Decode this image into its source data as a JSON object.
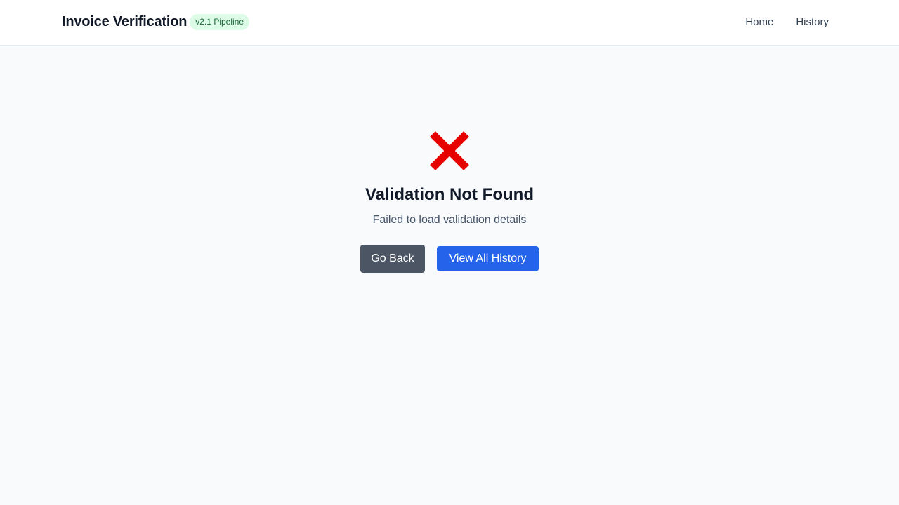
{
  "header": {
    "title": "Invoice Verification",
    "badge": "v2.1 Pipeline",
    "nav": [
      {
        "label": "Home"
      },
      {
        "label": "History"
      }
    ]
  },
  "main": {
    "icon": "red-x-icon",
    "heading": "Validation Not Found",
    "message": "Failed to load validation details",
    "buttons": {
      "back_label": "Go Back",
      "history_label": "View All History"
    }
  },
  "colors": {
    "error": "#e60000",
    "primary": "#2563eb",
    "secondary": "#4b5563",
    "badge_bg": "#dcfce7",
    "badge_text": "#166534"
  }
}
